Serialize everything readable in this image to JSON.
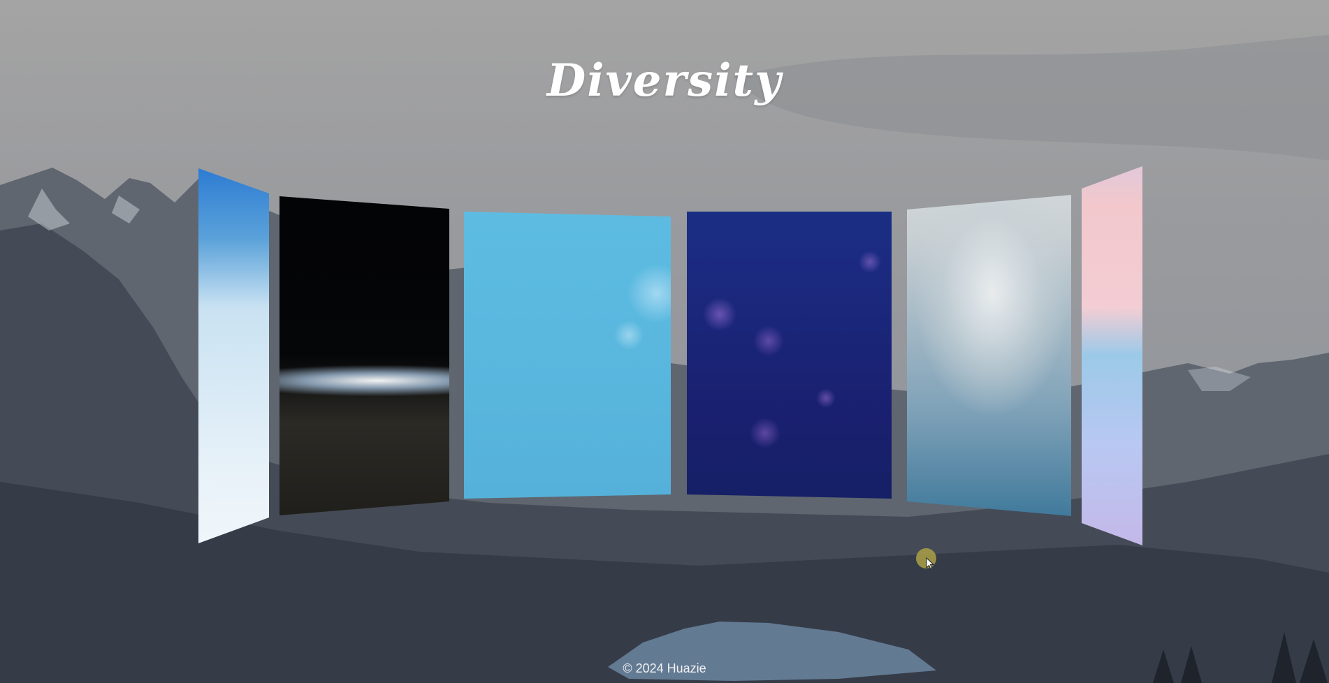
{
  "header": {
    "title": "Diversity"
  },
  "gallery": {
    "cards": [
      {
        "theme": "sky-clouds"
      },
      {
        "theme": "earth-horizon-space"
      },
      {
        "theme": "light-blue-bokeh"
      },
      {
        "theme": "deep-blue-bubbles"
      },
      {
        "theme": "misty-ocean-spray"
      },
      {
        "theme": "pastel-sunset-waves"
      }
    ]
  },
  "footer": {
    "copyright": "© 2024 Huazie"
  },
  "cursor": {
    "icon": "pointer-arrow-icon",
    "highlight_color": "#aaa046"
  },
  "colors": {
    "title": "#ffffff",
    "footer_text": "#f2f2f2"
  }
}
